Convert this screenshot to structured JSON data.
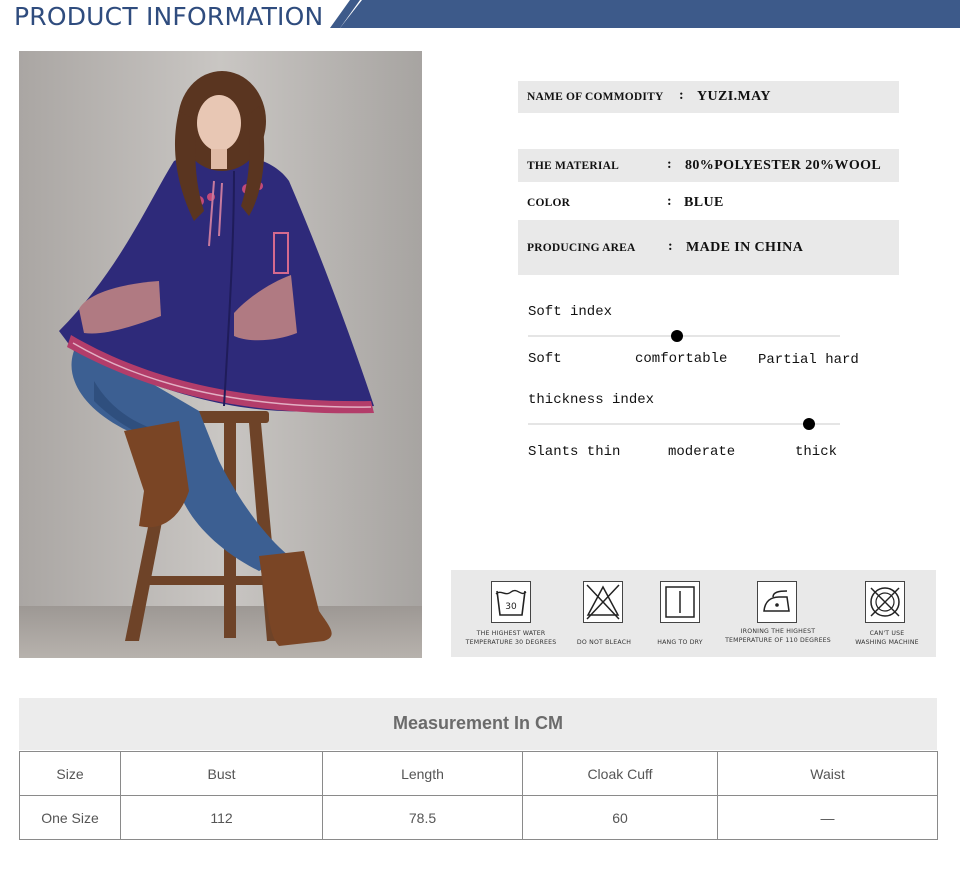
{
  "header": {
    "title": "PRODUCT INFORMATION"
  },
  "colors": {
    "header_blue": "#3d5a8a",
    "accent": "#2f4c7e",
    "panel_gray": "#e9e9e9"
  },
  "product_photo": {
    "alt": "Model wearing blue embroidered wool cloak"
  },
  "info": [
    {
      "key": "NAME OF COMMODITY",
      "colon": ":",
      "value": "YUZI.MAY"
    },
    {
      "key": "THE MATERIAL",
      "colon": ":",
      "value": "80%POLYESTER  20%WOOL"
    },
    {
      "key": "COLOR",
      "colon": ":",
      "value": "BLUE"
    },
    {
      "key": "PRODUCING AREA",
      "colon": ":",
      "value": "MADE IN CHINA"
    }
  ],
  "soft_index": {
    "title": "Soft index",
    "labels": [
      "Soft",
      "comfortable",
      "Partial hard"
    ],
    "selected": "comfortable"
  },
  "thickness_index": {
    "title": "thickness index",
    "labels": [
      "Slants thin",
      "moderate",
      "thick"
    ],
    "selected": "thick"
  },
  "care": [
    {
      "icon": "wash-30-icon",
      "wash_temp": "30",
      "line1": "THE HIGHEST WATER",
      "line2": "TEMPERATURE 30 DEGREES"
    },
    {
      "icon": "no-bleach-icon",
      "line1": "",
      "line2": "DO NOT BLEACH"
    },
    {
      "icon": "hang-dry-icon",
      "line1": "",
      "line2": "HANG TO DRY"
    },
    {
      "icon": "iron-110-icon",
      "line1": "IRONING THE HIGHEST",
      "line2": "TEMPERATURE OF 110 DEGREES"
    },
    {
      "icon": "no-machine-wash-icon",
      "line1": "CAN'T USE",
      "line2": "WASHING MACHINE"
    }
  ],
  "measurement": {
    "title": "Measurement In CM",
    "columns": [
      "Size",
      "Bust",
      "Length",
      "Cloak Cuff",
      "Waist"
    ],
    "rows": [
      [
        "One Size",
        "112",
        "78.5",
        "60",
        "—"
      ]
    ]
  }
}
